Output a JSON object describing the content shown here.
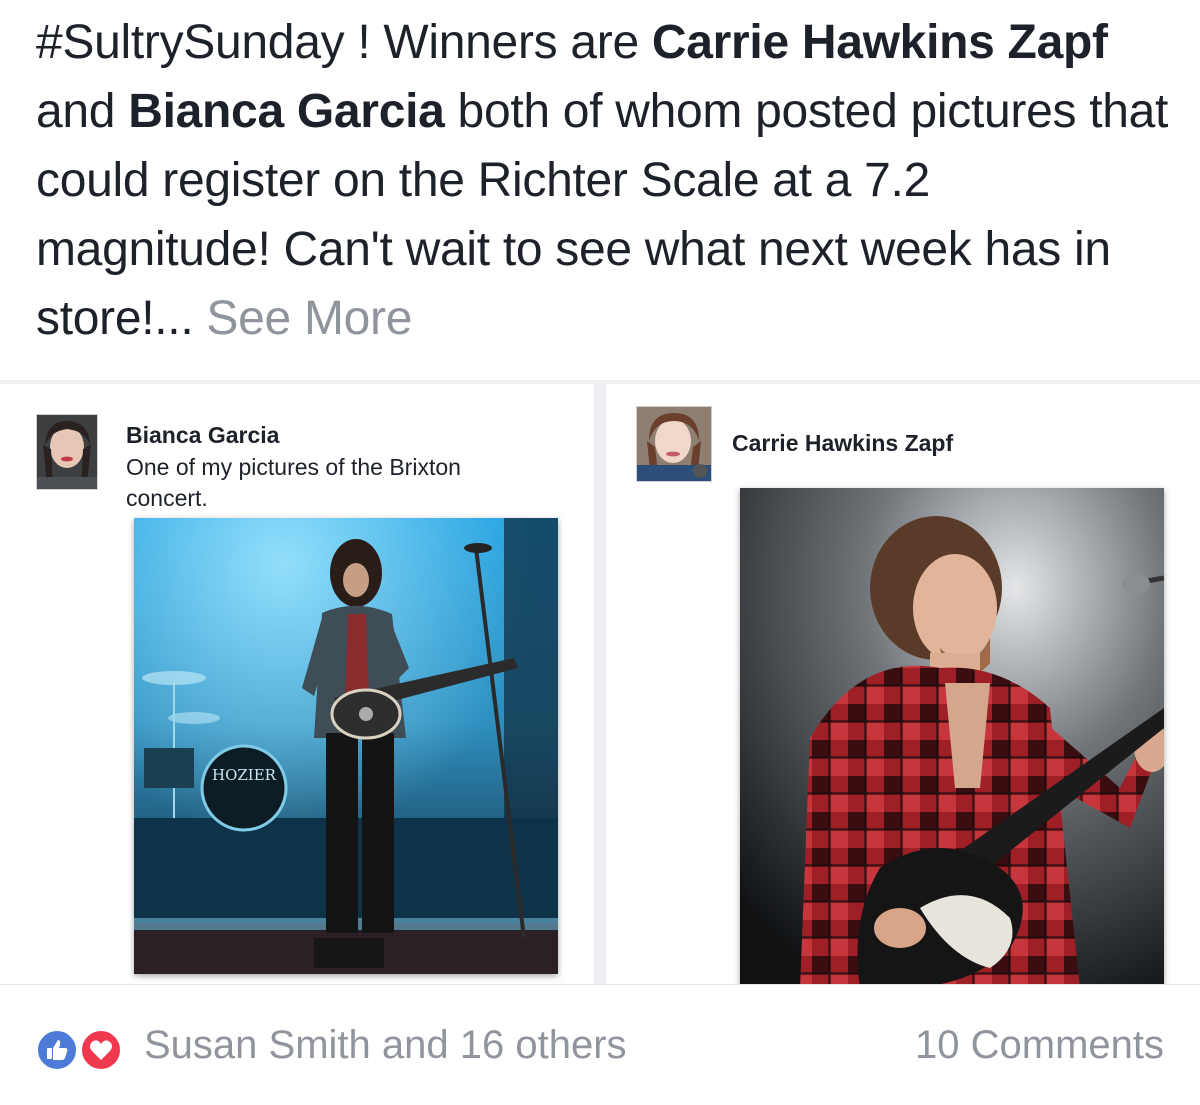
{
  "post": {
    "text_1": "#SultrySunday ! Winners are ",
    "name_1": "Carrie Hawkins Zapf",
    "text_2": " and ",
    "name_2": "Bianca Garcia",
    "text_3": " both of whom posted pictures that could register on the Richter Scale at a 7.2 magnitude! Can't wait to see what next week has in store!... ",
    "see_more": "See More"
  },
  "shared_posts": [
    {
      "author": "Bianca Garcia",
      "caption": "One of my pictures of the Brixton concert.",
      "drum_text": "HOZIER"
    },
    {
      "author": "Carrie Hawkins Zapf"
    }
  ],
  "footer": {
    "reactions_text": "Susan Smith and 16 others",
    "comments_text": "10 Comments"
  },
  "colors": {
    "text": "#1d2129",
    "muted": "#90949c",
    "like": "#4f7bd8",
    "love": "#f0394f"
  },
  "icons": [
    "like-reaction-icon",
    "love-reaction-icon"
  ]
}
